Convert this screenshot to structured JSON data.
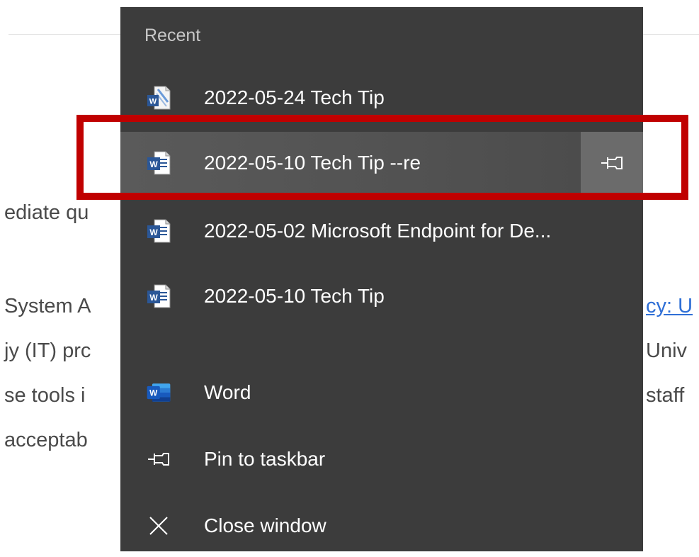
{
  "background_page": {
    "line1": "ediate qu",
    "line2_left": "System A",
    "line2_right_link": "cy: U",
    "line3_left": "jy (IT) prc",
    "line3_right": "Univ",
    "line4_left": "se tools i",
    "line4_right": "staff",
    "line5_left": "acceptab"
  },
  "jumplist": {
    "header": "Recent",
    "recent": [
      {
        "label": "2022-05-24 Tech Tip",
        "icon": "word-doc-icon"
      },
      {
        "label": "2022-05-10 Tech Tip --re",
        "icon": "word-doc-icon",
        "hovered": true
      },
      {
        "label": "2022-05-02 Microsoft Endpoint for De...",
        "icon": "word-doc-icon"
      },
      {
        "label": "2022-05-10 Tech Tip",
        "icon": "word-doc-icon"
      }
    ],
    "tasks": [
      {
        "label": "Word",
        "icon": "word-app-icon"
      },
      {
        "label": "Pin to taskbar",
        "icon": "pin-icon"
      },
      {
        "label": "Close window",
        "icon": "close-icon"
      }
    ]
  },
  "colors": {
    "panel_bg": "#3c3c3c",
    "highlight_border": "#c00000",
    "word_blue": "#2b5797"
  }
}
